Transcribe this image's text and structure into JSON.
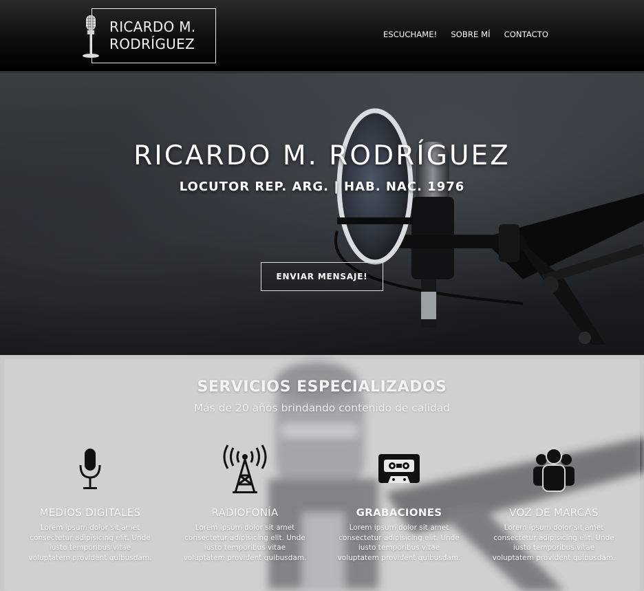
{
  "header": {
    "logo_text": "RICARDO M. RODRÍGUEZ",
    "nav": [
      "ESCUCHAME!",
      "SOBRE MÍ",
      "CONTACTO"
    ]
  },
  "hero": {
    "title": "RICARDO M. RODRÍGUEZ",
    "subtitle": "LOCUTOR REP. ARG. | HAB. NAC. 1976",
    "button": "ENVIAR MENSAJE!"
  },
  "services": {
    "title": "SERVICIOS ESPECIALIZADOS",
    "subtitle": "Más de 20 años brindando contenido de calidad",
    "items": [
      {
        "icon": "microphone-icon",
        "name": "MEDIOS DIGITALES",
        "desc": "Lorem ipsum dolor sit amet consectetur adipisicing elit. Unde iusto temporibus vitae voluptatem provident quibusdam."
      },
      {
        "icon": "radio-tower-icon",
        "name": "RADIOFONÍA",
        "desc": "Lorem ipsum dolor sit amet consectetur adipisicing elit. Unde iusto temporibus vitae voluptatem provident quibusdam."
      },
      {
        "icon": "cassette-icon",
        "name": "GRABACIONES",
        "desc": "Lorem ipsum dolor sit amet consectetur adipisicing elit. Unde iusto temporibus vitae voluptatem provident quibusdam."
      },
      {
        "icon": "people-icon",
        "name": "VOZ DE MARCAS",
        "desc": "Lorem ipsum dolor sit amet consectetur adipisicing elit. Unde iusto temporibus vitae voluptatem provident quibusdam."
      }
    ]
  },
  "colors": {
    "header_bg": "#0d0d0d",
    "services_bg": "#c9c9c9",
    "icon": "#111111",
    "text_light": "#ffffff"
  }
}
